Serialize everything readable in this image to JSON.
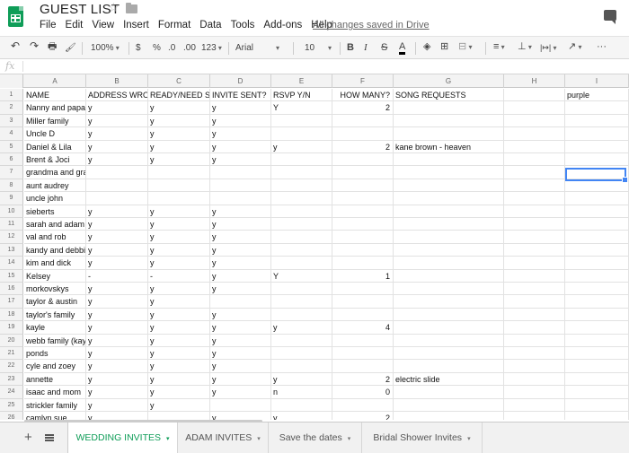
{
  "titlebar": {
    "title": "GUEST LIST",
    "menu": [
      "File",
      "Edit",
      "View",
      "Insert",
      "Format",
      "Data",
      "Tools",
      "Add-ons",
      "Help"
    ],
    "save_status": "All changes saved in Drive"
  },
  "toolbar": {
    "undo": "↶",
    "redo": "↷",
    "print": "🖶",
    "paint_format": "🖌",
    "zoom": "100%",
    "currency": "$",
    "percent": "%",
    "dec_decrease": ".0",
    "dec_increase": ".00",
    "more_formats": "123",
    "font": "Arial",
    "font_size": "10",
    "bold": "B",
    "italic": "I",
    "strike": "S",
    "text_color": "A",
    "fill_color": "◈",
    "borders": "⊞",
    "merge": "⊟",
    "align": "≡",
    "valign": "⊥",
    "wrap": "|↦|",
    "rotate": "↗",
    "more": "···"
  },
  "formula": {
    "fx": "fx"
  },
  "grid": {
    "columns": [
      "A",
      "B",
      "C",
      "D",
      "E",
      "F",
      "G",
      "H",
      "I"
    ],
    "rows": [
      {
        "n": "1",
        "c": [
          "NAME",
          "ADDRESS WRONG",
          "READY/NEED S",
          "INVITE SENT?",
          "RSVP Y/N",
          "HOW MANY?",
          "SONG REQUESTS",
          "",
          "purple"
        ]
      },
      {
        "n": "2",
        "c": [
          "Nanny and papaw",
          "y",
          "y",
          "y",
          "Y",
          "2",
          "",
          "",
          ""
        ]
      },
      {
        "n": "3",
        "c": [
          "Miller family",
          "y",
          "y",
          "y",
          "",
          "",
          "",
          "",
          ""
        ]
      },
      {
        "n": "4",
        "c": [
          "Uncle D",
          "y",
          "y",
          "y",
          "",
          "",
          "",
          "",
          ""
        ]
      },
      {
        "n": "5",
        "c": [
          "Daniel & Lila",
          "y",
          "y",
          "y",
          "y",
          "2",
          "kane brown - heaven",
          "",
          ""
        ]
      },
      {
        "n": "6",
        "c": [
          "Brent & Joci",
          "y",
          "y",
          "y",
          "",
          "",
          "",
          "",
          ""
        ]
      },
      {
        "n": "7",
        "c": [
          "grandma and grandpa",
          "",
          "",
          "",
          "",
          "",
          "",
          "",
          ""
        ]
      },
      {
        "n": "8",
        "c": [
          "aunt audrey",
          "",
          "",
          "",
          "",
          "",
          "",
          "",
          ""
        ]
      },
      {
        "n": "9",
        "c": [
          "uncle john",
          "",
          "",
          "",
          "",
          "",
          "",
          "",
          ""
        ]
      },
      {
        "n": "10",
        "c": [
          "sieberts",
          "y",
          "y",
          "y",
          "",
          "",
          "",
          "",
          ""
        ]
      },
      {
        "n": "11",
        "c": [
          "sarah and adam",
          "y",
          "y",
          "y",
          "",
          "",
          "",
          "",
          ""
        ]
      },
      {
        "n": "12",
        "c": [
          "val and rob",
          "y",
          "y",
          "y",
          "",
          "",
          "",
          "",
          ""
        ]
      },
      {
        "n": "13",
        "c": [
          "kandy and debbie",
          "y",
          "y",
          "y",
          "",
          "",
          "",
          "",
          ""
        ]
      },
      {
        "n": "14",
        "c": [
          "kim and dick",
          "y",
          "y",
          "y",
          "",
          "",
          "",
          "",
          ""
        ]
      },
      {
        "n": "15",
        "c": [
          "Kelsey",
          "-",
          "-",
          "y",
          "Y",
          "1",
          "",
          "",
          ""
        ]
      },
      {
        "n": "16",
        "c": [
          "morkovskys",
          "y",
          "y",
          "y",
          "",
          "",
          "",
          "",
          ""
        ]
      },
      {
        "n": "17",
        "c": [
          "taylor & austin",
          "y",
          "y",
          "",
          "",
          "",
          "",
          "",
          ""
        ]
      },
      {
        "n": "18",
        "c": [
          "taylor's family",
          "y",
          "y",
          "y",
          "",
          "",
          "",
          "",
          ""
        ]
      },
      {
        "n": "19",
        "c": [
          "kayle",
          "y",
          "y",
          "y",
          "y",
          "4",
          "",
          "",
          ""
        ]
      },
      {
        "n": "20",
        "c": [
          "webb family (kayl",
          "y",
          "y",
          "y",
          "",
          "",
          "",
          "",
          ""
        ]
      },
      {
        "n": "21",
        "c": [
          "ponds",
          "y",
          "y",
          "y",
          "",
          "",
          "",
          "",
          ""
        ]
      },
      {
        "n": "22",
        "c": [
          "cyle and zoey",
          "y",
          "y",
          "y",
          "",
          "",
          "",
          "",
          ""
        ]
      },
      {
        "n": "23",
        "c": [
          "annette",
          "y",
          "y",
          "y",
          "y",
          "2",
          "electric slide",
          "",
          ""
        ]
      },
      {
        "n": "24",
        "c": [
          "isaac and mom",
          "y",
          "y",
          "y",
          "n",
          "0",
          "",
          "",
          ""
        ]
      },
      {
        "n": "25",
        "c": [
          "strickler family",
          "y",
          "y",
          "",
          "",
          "",
          "",
          "",
          ""
        ]
      },
      {
        "n": "26",
        "c": [
          "camlyn sue",
          "y",
          "",
          "y",
          "y",
          "2",
          "",
          "",
          ""
        ]
      }
    ]
  },
  "sheets": {
    "add": "+",
    "tabs": [
      "WEDDING INVITES",
      "ADAM INVITES",
      "Save the dates",
      "Bridal Shower Invites"
    ],
    "caret": "▾"
  },
  "colors": {
    "brand": "#0f9d58",
    "selection": "#4285f4"
  }
}
